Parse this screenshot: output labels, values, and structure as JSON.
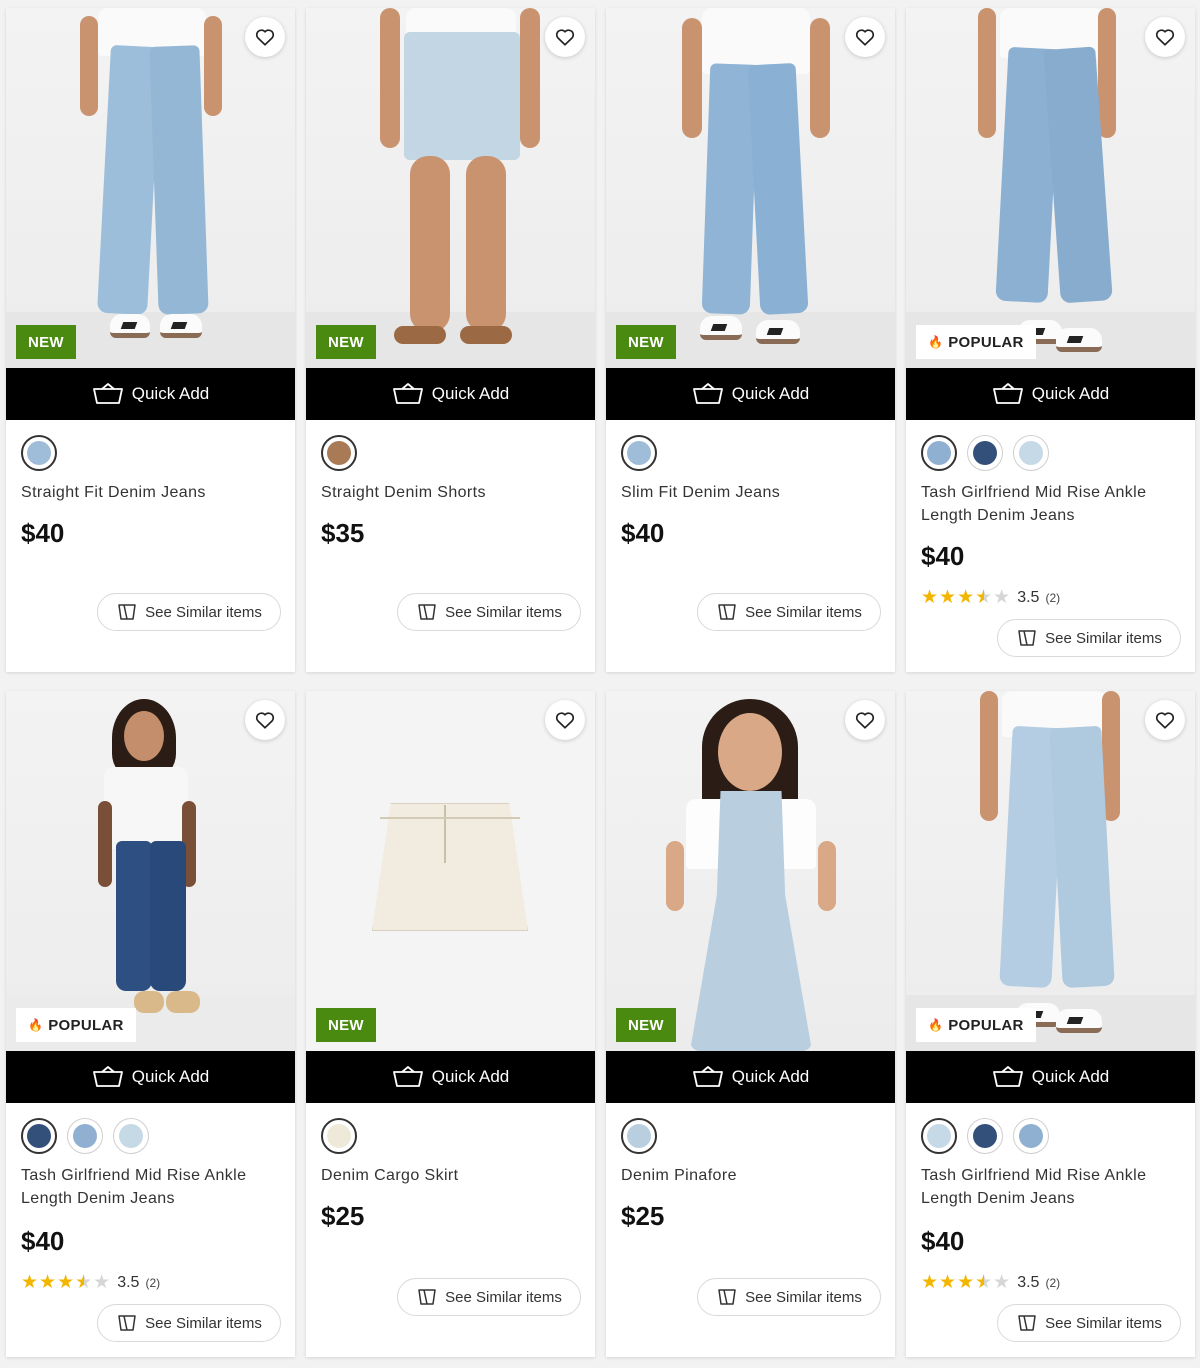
{
  "labels": {
    "quick_add": "Quick Add",
    "see_similar": "See Similar items"
  },
  "colors": {
    "new_badge": "#4b8a10",
    "quick_add_bg": "#000000",
    "star": "#f2b600"
  },
  "products": [
    {
      "name": "Straight Fit Denim Jeans",
      "price": "$40",
      "badge": "NEW",
      "badge_type": "new",
      "swatch_colors": [
        "#9fbdd8"
      ],
      "selected_swatch": 0,
      "rating": null,
      "review_count": null
    },
    {
      "name": "Straight Denim Shorts",
      "price": "$35",
      "badge": "NEW",
      "badge_type": "new",
      "swatch_colors": [
        "#a87a55"
      ],
      "selected_swatch": 0,
      "rating": null,
      "review_count": null
    },
    {
      "name": "Slim Fit Denim Jeans",
      "price": "$40",
      "badge": "NEW",
      "badge_type": "new",
      "swatch_colors": [
        "#9fbdd8"
      ],
      "selected_swatch": 0,
      "rating": null,
      "review_count": null
    },
    {
      "name": "Tash Girlfriend Mid Rise Ankle Length Denim Jeans",
      "price": "$40",
      "badge": "POPULAR",
      "badge_type": "popular",
      "swatch_colors": [
        "#8fb0d0",
        "#33507a",
        "#c6d9e6"
      ],
      "selected_swatch": 0,
      "rating": "3.5",
      "review_count": "(2)"
    },
    {
      "name": "Tash Girlfriend Mid Rise Ankle Length Denim Jeans",
      "price": "$40",
      "badge": "POPULAR",
      "badge_type": "popular",
      "swatch_colors": [
        "#33507a",
        "#8fb0d0",
        "#c6d9e6"
      ],
      "selected_swatch": 0,
      "rating": "3.5",
      "review_count": "(2)"
    },
    {
      "name": "Denim Cargo Skirt",
      "price": "$25",
      "badge": "NEW",
      "badge_type": "new",
      "swatch_colors": [
        "#efe9da"
      ],
      "selected_swatch": 0,
      "rating": null,
      "review_count": null
    },
    {
      "name": "Denim Pinafore",
      "price": "$25",
      "badge": "NEW",
      "badge_type": "new",
      "swatch_colors": [
        "#b9cfe0"
      ],
      "selected_swatch": 0,
      "rating": null,
      "review_count": null
    },
    {
      "name": "Tash Girlfriend Mid Rise Ankle Length Denim Jeans",
      "price": "$40",
      "badge": "POPULAR",
      "badge_type": "popular",
      "swatch_colors": [
        "#c6d9e6",
        "#33507a",
        "#8fb0d0"
      ],
      "selected_swatch": 0,
      "rating": "3.5",
      "review_count": "(2)"
    }
  ]
}
